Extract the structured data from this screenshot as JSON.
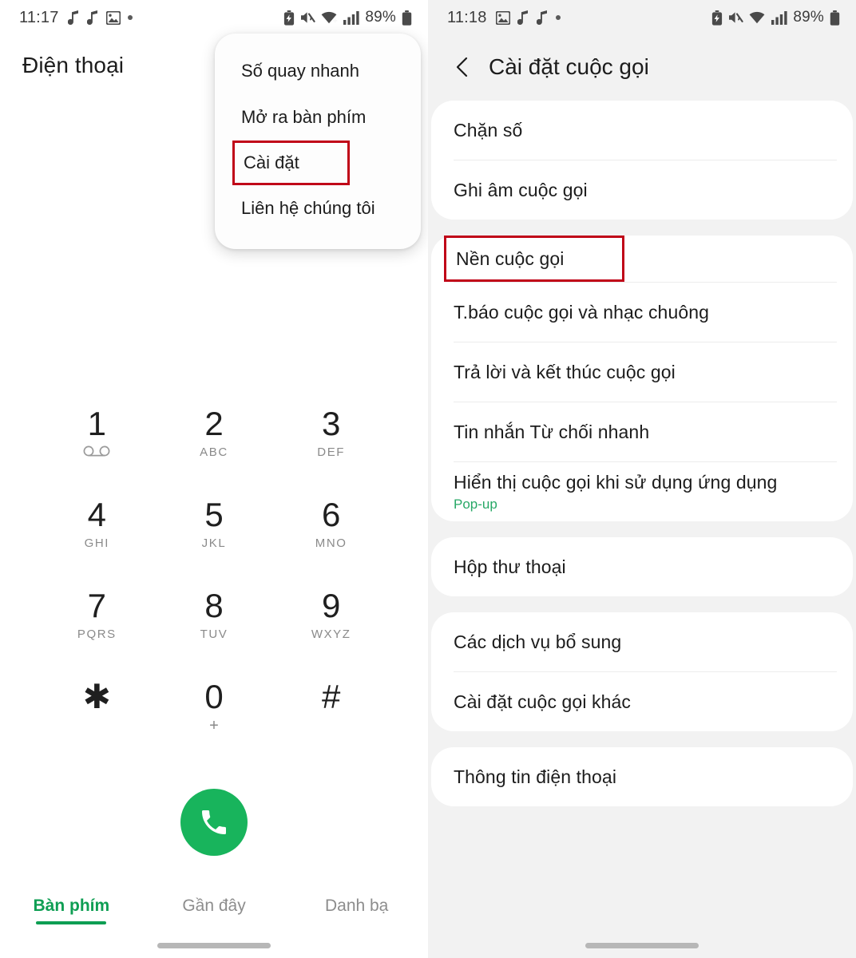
{
  "left": {
    "status_bar": {
      "time": "11:17",
      "left_icons": [
        "music-note-icon",
        "music-note-icon",
        "image-icon",
        "dot-icon"
      ],
      "right_icons": [
        "battery-saver-icon",
        "mute-icon",
        "wifi-icon",
        "signal-icon"
      ],
      "battery_percent": "89%"
    },
    "app_title": "Điện thoại",
    "dropdown": {
      "items": [
        {
          "label": "Số quay nhanh",
          "highlighted": false
        },
        {
          "label": "Mở ra bàn phím",
          "highlighted": false
        },
        {
          "label": "Cài đặt",
          "highlighted": true
        },
        {
          "label": "Liên hệ chúng tôi",
          "highlighted": false
        }
      ]
    },
    "keypad": [
      {
        "digit": "1",
        "sub": "",
        "icon": "voicemail-icon"
      },
      {
        "digit": "2",
        "sub": "ABC",
        "icon": ""
      },
      {
        "digit": "3",
        "sub": "DEF",
        "icon": ""
      },
      {
        "digit": "4",
        "sub": "GHI",
        "icon": ""
      },
      {
        "digit": "5",
        "sub": "JKL",
        "icon": ""
      },
      {
        "digit": "6",
        "sub": "MNO",
        "icon": ""
      },
      {
        "digit": "7",
        "sub": "PQRS",
        "icon": ""
      },
      {
        "digit": "8",
        "sub": "TUV",
        "icon": ""
      },
      {
        "digit": "9",
        "sub": "WXYZ",
        "icon": ""
      },
      {
        "digit": "✱",
        "sub": "",
        "icon": ""
      },
      {
        "digit": "0",
        "sub": "+",
        "icon": ""
      },
      {
        "digit": "#",
        "sub": "",
        "icon": ""
      }
    ],
    "call_button": {
      "icon": "phone-call-icon",
      "color": "#18b45c"
    },
    "tabs": [
      {
        "label": "Bàn phím",
        "active": true
      },
      {
        "label": "Gần đây",
        "active": false
      },
      {
        "label": "Danh bạ",
        "active": false
      }
    ]
  },
  "right": {
    "status_bar": {
      "time": "11:18",
      "left_icons": [
        "image-icon",
        "music-note-icon",
        "music-note-icon",
        "dot-icon"
      ],
      "right_icons": [
        "battery-saver-icon",
        "mute-icon",
        "wifi-icon",
        "signal-icon"
      ],
      "battery_percent": "89%"
    },
    "header": {
      "back_icon": "chevron-left-icon",
      "title": "Cài đặt cuộc gọi"
    },
    "groups": [
      {
        "items": [
          {
            "title": "Chặn số",
            "sub": "",
            "highlighted": false
          },
          {
            "title": "Ghi âm cuộc gọi",
            "sub": "",
            "highlighted": false
          }
        ]
      },
      {
        "items": [
          {
            "title": "Nền cuộc gọi",
            "sub": "",
            "highlighted": true
          },
          {
            "title": "T.báo cuộc gọi và nhạc chuông",
            "sub": "",
            "highlighted": false
          },
          {
            "title": "Trả lời và kết thúc cuộc gọi",
            "sub": "",
            "highlighted": false
          },
          {
            "title": "Tin nhắn Từ chối nhanh",
            "sub": "",
            "highlighted": false
          },
          {
            "title": "Hiển thị cuộc gọi khi sử dụng ứng dụng",
            "sub": "Pop-up",
            "highlighted": false
          }
        ]
      },
      {
        "items": [
          {
            "title": "Hộp thư thoại",
            "sub": "",
            "highlighted": false
          }
        ]
      },
      {
        "items": [
          {
            "title": "Các dịch vụ bổ sung",
            "sub": "",
            "highlighted": false
          },
          {
            "title": "Cài đặt cuộc gọi khác",
            "sub": "",
            "highlighted": false
          }
        ]
      },
      {
        "items": [
          {
            "title": "Thông tin điện thoại",
            "sub": "",
            "highlighted": false
          }
        ]
      }
    ]
  },
  "colors": {
    "accent_green": "#0e9e53",
    "highlight_red": "#c00418",
    "panel_bg": "#f2f2f2",
    "card_bg": "#ffffff",
    "subtitle_green": "#27a866"
  }
}
